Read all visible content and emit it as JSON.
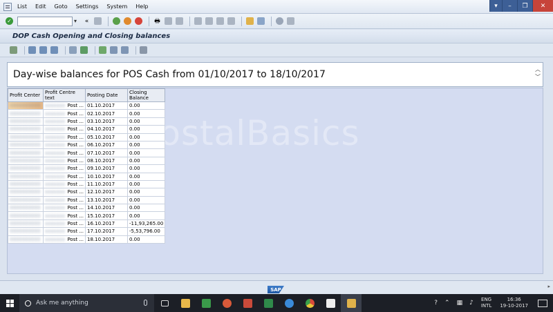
{
  "menu": {
    "items": [
      "List",
      "Edit",
      "Goto",
      "Settings",
      "System",
      "Help"
    ]
  },
  "title": "DOP Cash Opening and Closing balances",
  "header": "Day-wise balances for POS Cash from 01/10/2017 to 18/10/2017",
  "watermark": "PostalBasics",
  "table": {
    "columns": [
      "Profit Center",
      "Profit Centre text",
      "Posting Date",
      "Closing Balance"
    ],
    "rows": [
      {
        "pct": "Post ...",
        "date": "01.10.2017",
        "balance": "0.00"
      },
      {
        "pct": "Post ...",
        "date": "02.10.2017",
        "balance": "0.00"
      },
      {
        "pct": "Post ...",
        "date": "03.10.2017",
        "balance": "0.00"
      },
      {
        "pct": "Post ...",
        "date": "04.10.2017",
        "balance": "0.00"
      },
      {
        "pct": "Post ...",
        "date": "05.10.2017",
        "balance": "0.00"
      },
      {
        "pct": "Post ...",
        "date": "06.10.2017",
        "balance": "0.00"
      },
      {
        "pct": "Post ...",
        "date": "07.10.2017",
        "balance": "0.00"
      },
      {
        "pct": "Post ...",
        "date": "08.10.2017",
        "balance": "0.00"
      },
      {
        "pct": "Post ...",
        "date": "09.10.2017",
        "balance": "0.00"
      },
      {
        "pct": "Post ...",
        "date": "10.10.2017",
        "balance": "0.00"
      },
      {
        "pct": "Post ...",
        "date": "11.10.2017",
        "balance": "0.00"
      },
      {
        "pct": "Post ...",
        "date": "12.10.2017",
        "balance": "0.00"
      },
      {
        "pct": "Post ...",
        "date": "13.10.2017",
        "balance": "0.00"
      },
      {
        "pct": "Post ...",
        "date": "14.10.2017",
        "balance": "0.00"
      },
      {
        "pct": "Post ...",
        "date": "15.10.2017",
        "balance": "0.00"
      },
      {
        "pct": "Post ...",
        "date": "16.10.2017",
        "balance": "-11,93,265.00"
      },
      {
        "pct": "Post ...",
        "date": "17.10.2017",
        "balance": "-5,53,796.00"
      },
      {
        "pct": "Post ...",
        "date": "18.10.2017",
        "balance": "0.00"
      }
    ]
  },
  "status": {
    "logo": "SAP"
  },
  "taskbar": {
    "search_placeholder": "Ask me anything",
    "lang_line1": "ENG",
    "lang_line2": "INTL",
    "time": "16:36",
    "date": "19-10-2017"
  },
  "colors": {
    "content_bg": "#d4dcf1",
    "taskbar_bg": "#1c1f26"
  }
}
